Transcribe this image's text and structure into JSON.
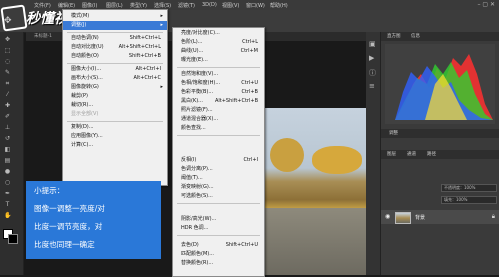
{
  "menubar": {
    "items": [
      "文件(F)",
      "编辑(E)",
      "图像(I)",
      "图层(L)",
      "类型(Y)",
      "选择(S)",
      "滤镜(T)",
      "3D(D)",
      "视图(V)",
      "窗口(W)",
      "帮助(H)"
    ]
  },
  "logo": {
    "text": "秒懂视频"
  },
  "document": {
    "tab_label": "未标题-1"
  },
  "image_menu": {
    "items": [
      {
        "label": "模式(M)",
        "shortcut": "",
        "submenu": true
      },
      {
        "label": "调整(J)",
        "shortcut": "",
        "submenu": true,
        "highlighted": true
      },
      {
        "label": "自动色调(N)",
        "shortcut": "Shift+Ctrl+L"
      },
      {
        "label": "自动对比度(U)",
        "shortcut": "Alt+Shift+Ctrl+L"
      },
      {
        "label": "自动颜色(O)",
        "shortcut": "Shift+Ctrl+B"
      },
      {
        "label": "图像大小(I)...",
        "shortcut": "Alt+Ctrl+I"
      },
      {
        "label": "画布大小(S)...",
        "shortcut": "Alt+Ctrl+C"
      },
      {
        "label": "图像旋转(G)",
        "shortcut": "",
        "submenu": true
      },
      {
        "label": "裁剪(P)",
        "shortcut": ""
      },
      {
        "label": "裁切(R)...",
        "shortcut": ""
      },
      {
        "label": "显示全部(V)",
        "shortcut": "",
        "disabled": true
      },
      {
        "label": "复制(D)...",
        "shortcut": ""
      },
      {
        "label": "应用图像(Y)...",
        "shortcut": ""
      },
      {
        "label": "计算(C)...",
        "shortcut": ""
      }
    ]
  },
  "adjust_menu": {
    "items": [
      {
        "label": "亮度/对比度(C)...",
        "shortcut": ""
      },
      {
        "label": "色阶(L)...",
        "shortcut": "Ctrl+L"
      },
      {
        "label": "曲线(U)...",
        "shortcut": "Ctrl+M"
      },
      {
        "label": "曝光度(E)...",
        "shortcut": ""
      },
      {
        "label": "自然饱和度(V)...",
        "shortcut": ""
      },
      {
        "label": "色相/饱和度(H)...",
        "shortcut": "Ctrl+U"
      },
      {
        "label": "色彩平衡(B)...",
        "shortcut": "Ctrl+B"
      },
      {
        "label": "黑白(K)...",
        "shortcut": "Alt+Shift+Ctrl+B"
      },
      {
        "label": "照片滤镜(F)...",
        "shortcut": ""
      },
      {
        "label": "通道混合器(X)...",
        "shortcut": ""
      },
      {
        "label": "颜色查找...",
        "shortcut": ""
      },
      {
        "label": "反相(I)",
        "shortcut": "Ctrl+I"
      },
      {
        "label": "色调分离(P)...",
        "shortcut": ""
      },
      {
        "label": "阈值(T)...",
        "shortcut": ""
      },
      {
        "label": "渐变映射(G)...",
        "shortcut": ""
      },
      {
        "label": "可选颜色(S)...",
        "shortcut": ""
      },
      {
        "label": "阴影/高光(W)...",
        "shortcut": ""
      },
      {
        "label": "HDR 色调...",
        "shortcut": ""
      },
      {
        "label": "去色(D)",
        "shortcut": "Shift+Ctrl+U"
      },
      {
        "label": "匹配颜色(M)...",
        "shortcut": ""
      },
      {
        "label": "替换颜色(R)...",
        "shortcut": ""
      }
    ]
  },
  "tip": {
    "lines": [
      "小提示：",
      "图像一调整一亮度/对",
      "比度一调节亮度，对",
      "比度也同理一确定"
    ]
  },
  "right_panel": {
    "tab1": "直方图",
    "tab2": "信息",
    "tab3": "调整",
    "tab4": "图层",
    "tab5": "通道",
    "tab6": "路径",
    "layer_name": "背景",
    "opacity": "不透明度：100%",
    "fill": "填充：100%"
  },
  "colors": {
    "menu_highlight": "#3a7ad6",
    "tip_bg": "#2a78d8"
  }
}
